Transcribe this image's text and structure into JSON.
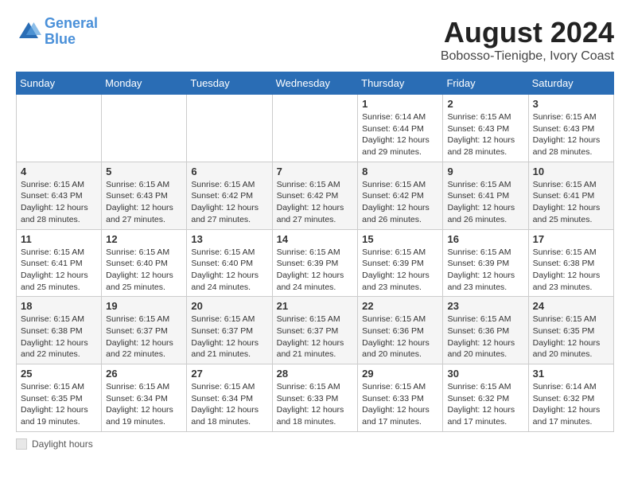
{
  "header": {
    "logo_line1": "General",
    "logo_line2": "Blue",
    "month_year": "August 2024",
    "location": "Bobosso-Tienigbe, Ivory Coast"
  },
  "days_of_week": [
    "Sunday",
    "Monday",
    "Tuesday",
    "Wednesday",
    "Thursday",
    "Friday",
    "Saturday"
  ],
  "footer": {
    "note": "Daylight hours"
  },
  "weeks": [
    [
      {
        "day": "",
        "info": ""
      },
      {
        "day": "",
        "info": ""
      },
      {
        "day": "",
        "info": ""
      },
      {
        "day": "",
        "info": ""
      },
      {
        "day": "1",
        "info": "Sunrise: 6:14 AM\nSunset: 6:44 PM\nDaylight: 12 hours\nand 29 minutes."
      },
      {
        "day": "2",
        "info": "Sunrise: 6:15 AM\nSunset: 6:43 PM\nDaylight: 12 hours\nand 28 minutes."
      },
      {
        "day": "3",
        "info": "Sunrise: 6:15 AM\nSunset: 6:43 PM\nDaylight: 12 hours\nand 28 minutes."
      }
    ],
    [
      {
        "day": "4",
        "info": "Sunrise: 6:15 AM\nSunset: 6:43 PM\nDaylight: 12 hours\nand 28 minutes."
      },
      {
        "day": "5",
        "info": "Sunrise: 6:15 AM\nSunset: 6:43 PM\nDaylight: 12 hours\nand 27 minutes."
      },
      {
        "day": "6",
        "info": "Sunrise: 6:15 AM\nSunset: 6:42 PM\nDaylight: 12 hours\nand 27 minutes."
      },
      {
        "day": "7",
        "info": "Sunrise: 6:15 AM\nSunset: 6:42 PM\nDaylight: 12 hours\nand 27 minutes."
      },
      {
        "day": "8",
        "info": "Sunrise: 6:15 AM\nSunset: 6:42 PM\nDaylight: 12 hours\nand 26 minutes."
      },
      {
        "day": "9",
        "info": "Sunrise: 6:15 AM\nSunset: 6:41 PM\nDaylight: 12 hours\nand 26 minutes."
      },
      {
        "day": "10",
        "info": "Sunrise: 6:15 AM\nSunset: 6:41 PM\nDaylight: 12 hours\nand 25 minutes."
      }
    ],
    [
      {
        "day": "11",
        "info": "Sunrise: 6:15 AM\nSunset: 6:41 PM\nDaylight: 12 hours\nand 25 minutes."
      },
      {
        "day": "12",
        "info": "Sunrise: 6:15 AM\nSunset: 6:40 PM\nDaylight: 12 hours\nand 25 minutes."
      },
      {
        "day": "13",
        "info": "Sunrise: 6:15 AM\nSunset: 6:40 PM\nDaylight: 12 hours\nand 24 minutes."
      },
      {
        "day": "14",
        "info": "Sunrise: 6:15 AM\nSunset: 6:39 PM\nDaylight: 12 hours\nand 24 minutes."
      },
      {
        "day": "15",
        "info": "Sunrise: 6:15 AM\nSunset: 6:39 PM\nDaylight: 12 hours\nand 23 minutes."
      },
      {
        "day": "16",
        "info": "Sunrise: 6:15 AM\nSunset: 6:39 PM\nDaylight: 12 hours\nand 23 minutes."
      },
      {
        "day": "17",
        "info": "Sunrise: 6:15 AM\nSunset: 6:38 PM\nDaylight: 12 hours\nand 23 minutes."
      }
    ],
    [
      {
        "day": "18",
        "info": "Sunrise: 6:15 AM\nSunset: 6:38 PM\nDaylight: 12 hours\nand 22 minutes."
      },
      {
        "day": "19",
        "info": "Sunrise: 6:15 AM\nSunset: 6:37 PM\nDaylight: 12 hours\nand 22 minutes."
      },
      {
        "day": "20",
        "info": "Sunrise: 6:15 AM\nSunset: 6:37 PM\nDaylight: 12 hours\nand 21 minutes."
      },
      {
        "day": "21",
        "info": "Sunrise: 6:15 AM\nSunset: 6:37 PM\nDaylight: 12 hours\nand 21 minutes."
      },
      {
        "day": "22",
        "info": "Sunrise: 6:15 AM\nSunset: 6:36 PM\nDaylight: 12 hours\nand 20 minutes."
      },
      {
        "day": "23",
        "info": "Sunrise: 6:15 AM\nSunset: 6:36 PM\nDaylight: 12 hours\nand 20 minutes."
      },
      {
        "day": "24",
        "info": "Sunrise: 6:15 AM\nSunset: 6:35 PM\nDaylight: 12 hours\nand 20 minutes."
      }
    ],
    [
      {
        "day": "25",
        "info": "Sunrise: 6:15 AM\nSunset: 6:35 PM\nDaylight: 12 hours\nand 19 minutes."
      },
      {
        "day": "26",
        "info": "Sunrise: 6:15 AM\nSunset: 6:34 PM\nDaylight: 12 hours\nand 19 minutes."
      },
      {
        "day": "27",
        "info": "Sunrise: 6:15 AM\nSunset: 6:34 PM\nDaylight: 12 hours\nand 18 minutes."
      },
      {
        "day": "28",
        "info": "Sunrise: 6:15 AM\nSunset: 6:33 PM\nDaylight: 12 hours\nand 18 minutes."
      },
      {
        "day": "29",
        "info": "Sunrise: 6:15 AM\nSunset: 6:33 PM\nDaylight: 12 hours\nand 17 minutes."
      },
      {
        "day": "30",
        "info": "Sunrise: 6:15 AM\nSunset: 6:32 PM\nDaylight: 12 hours\nand 17 minutes."
      },
      {
        "day": "31",
        "info": "Sunrise: 6:14 AM\nSunset: 6:32 PM\nDaylight: 12 hours\nand 17 minutes."
      }
    ]
  ]
}
